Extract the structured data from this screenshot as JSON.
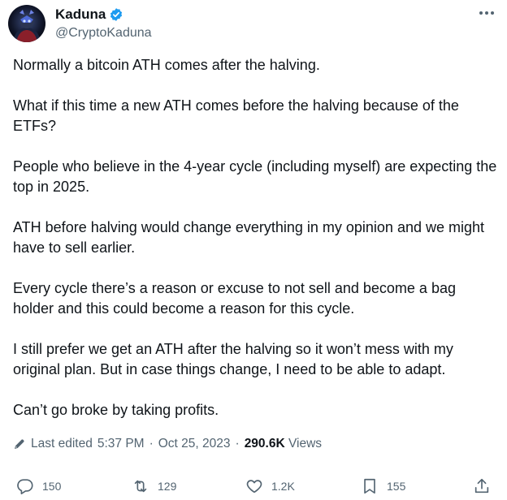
{
  "author": {
    "display_name": "Kaduna",
    "handle": "@CryptoKaduna",
    "verified": true
  },
  "post": {
    "paragraphs": [
      "Normally a bitcoin ATH comes after the halving.",
      "What if this time a new ATH comes before the halving because of the ETFs?",
      "People who believe in the 4-year cycle (including myself) are expecting the top in 2025.",
      "ATH before halving would change everything in my opinion and we might have to sell earlier.",
      "Every cycle there’s a reason or excuse to not sell and become a bag holder and this could become a reason for this cycle.",
      "I still prefer we get an ATH after the halving so it won’t mess with my original plan. But in case things change, I need to be able to adapt.",
      "Can’t go broke by taking profits."
    ]
  },
  "meta": {
    "edited_label": "Last edited",
    "time": "5:37 PM",
    "separator": "·",
    "date": "Oct 25, 2023",
    "views_count": "290.6K",
    "views_label": "Views"
  },
  "actions": {
    "replies": "150",
    "reposts": "129",
    "likes": "1.2K",
    "bookmarks": "155"
  },
  "icons": {
    "verified": "verified-badge-icon",
    "more": "more-options-icon",
    "edit": "pencil-icon",
    "reply": "reply-icon",
    "repost": "repost-icon",
    "like": "heart-icon",
    "bookmark": "bookmark-icon",
    "share": "share-icon"
  },
  "colors": {
    "text": "#0f1419",
    "secondary": "#536471",
    "verified": "#1d9bf0"
  }
}
